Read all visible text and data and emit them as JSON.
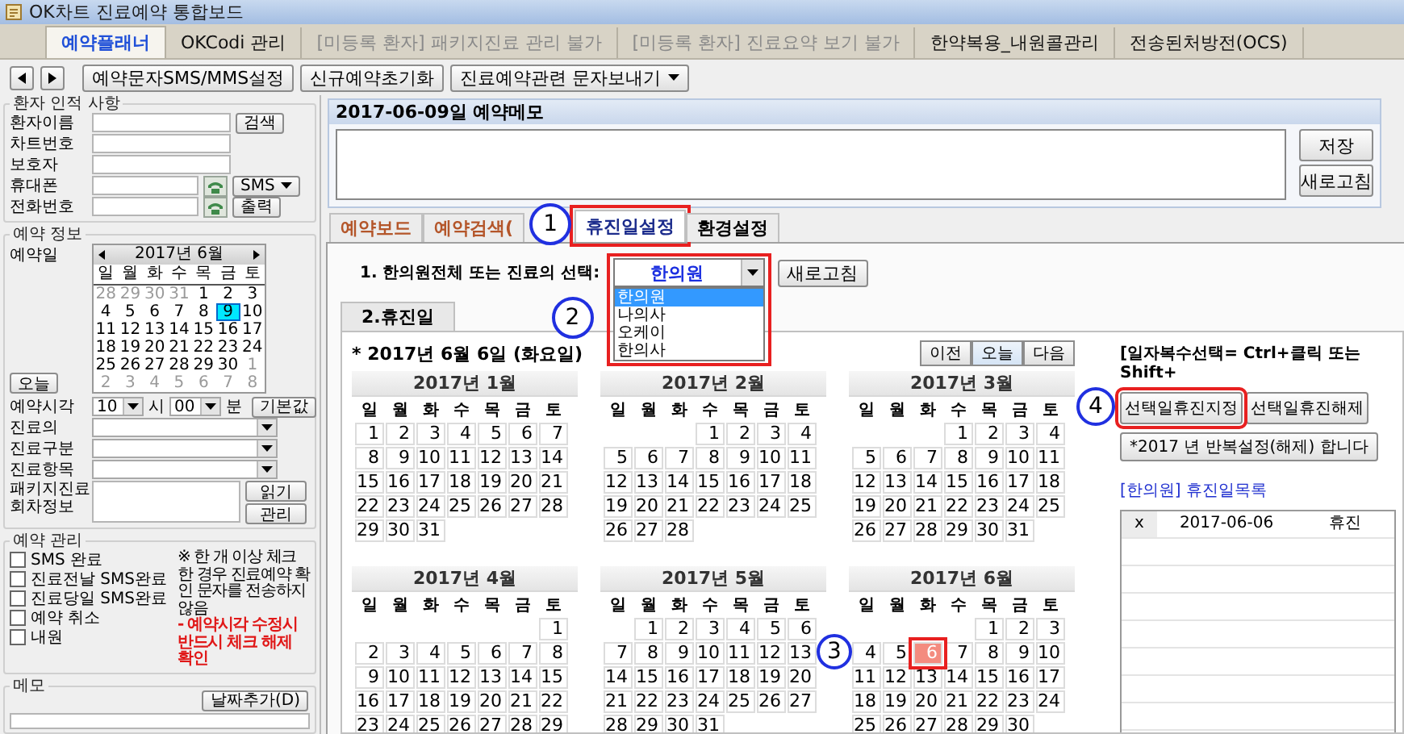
{
  "window": {
    "title": "OK차트 진료예약 통합보드"
  },
  "menu_tabs": [
    {
      "label": "예약플래너",
      "selected": true,
      "disabled": false
    },
    {
      "label": "OKCodi 관리",
      "selected": false,
      "disabled": false
    },
    {
      "label": "[미등록 환자] 패키지진료 관리 불가",
      "selected": false,
      "disabled": true
    },
    {
      "label": "[미등록 환자] 진료요약 보기 불가",
      "selected": false,
      "disabled": true
    },
    {
      "label": "한약복용_내원콜관리",
      "selected": false,
      "disabled": false
    },
    {
      "label": "전송된처방전(OCS)",
      "selected": false,
      "disabled": false
    }
  ],
  "toolbar": {
    "buttons": [
      {
        "label": "예약문자SMS/MMS설정",
        "dropdown": false
      },
      {
        "label": "신규예약초기화",
        "dropdown": false
      },
      {
        "label": "진료예약관련 문자보내기",
        "dropdown": true
      }
    ]
  },
  "patient": {
    "title": "환자 인적 사항",
    "fields": [
      {
        "label": "환자이름",
        "kind": "search",
        "button": "검색",
        "dropdown": false
      },
      {
        "label": "차트번호",
        "kind": "plain"
      },
      {
        "label": "보호자",
        "kind": "plain"
      },
      {
        "label": "휴대폰",
        "kind": "phone",
        "button": "SMS",
        "dropdown": true
      },
      {
        "label": "전화번호",
        "kind": "phone",
        "button": "출력",
        "dropdown": false
      }
    ]
  },
  "reservation": {
    "title": "예약 정보",
    "date_label": "예약일",
    "today_button": "오늘",
    "calendar": {
      "title": "2017년 6월",
      "weekdays": [
        "일",
        "월",
        "화",
        "수",
        "목",
        "금",
        "토"
      ],
      "weeks": [
        [
          {
            "day": "28",
            "other_month": true,
            "selected": false
          },
          {
            "day": "29",
            "other_month": true,
            "selected": false
          },
          {
            "day": "30",
            "other_month": true,
            "selected": false
          },
          {
            "day": "31",
            "other_month": true,
            "selected": false
          },
          {
            "day": "1",
            "other_month": false,
            "selected": false
          },
          {
            "day": "2",
            "other_month": false,
            "selected": false
          },
          {
            "day": "3",
            "other_month": false,
            "selected": false
          }
        ],
        [
          {
            "day": "4",
            "other_month": false,
            "selected": false
          },
          {
            "day": "5",
            "other_month": false,
            "selected": false
          },
          {
            "day": "6",
            "other_month": false,
            "selected": false
          },
          {
            "day": "7",
            "other_month": false,
            "selected": false
          },
          {
            "day": "8",
            "other_month": false,
            "selected": false
          },
          {
            "day": "9",
            "other_month": false,
            "selected": true
          },
          {
            "day": "10",
            "other_month": false,
            "selected": false
          }
        ],
        [
          {
            "day": "11",
            "other_month": false,
            "selected": false
          },
          {
            "day": "12",
            "other_month": false,
            "selected": false
          },
          {
            "day": "13",
            "other_month": false,
            "selected": false
          },
          {
            "day": "14",
            "other_month": false,
            "selected": false
          },
          {
            "day": "15",
            "other_month": false,
            "selected": false
          },
          {
            "day": "16",
            "other_month": false,
            "selected": false
          },
          {
            "day": "17",
            "other_month": false,
            "selected": false
          }
        ],
        [
          {
            "day": "18",
            "other_month": false,
            "selected": false
          },
          {
            "day": "19",
            "other_month": false,
            "selected": false
          },
          {
            "day": "20",
            "other_month": false,
            "selected": false
          },
          {
            "day": "21",
            "other_month": false,
            "selected": false
          },
          {
            "day": "22",
            "other_month": false,
            "selected": false
          },
          {
            "day": "23",
            "other_month": false,
            "selected": false
          },
          {
            "day": "24",
            "other_month": false,
            "selected": false
          }
        ],
        [
          {
            "day": "25",
            "other_month": false,
            "selected": false
          },
          {
            "day": "26",
            "other_month": false,
            "selected": false
          },
          {
            "day": "27",
            "other_month": false,
            "selected": false
          },
          {
            "day": "28",
            "other_month": false,
            "selected": false
          },
          {
            "day": "29",
            "other_month": false,
            "selected": false
          },
          {
            "day": "30",
            "other_month": false,
            "selected": false
          },
          {
            "day": "1",
            "other_month": true,
            "selected": false
          }
        ],
        [
          {
            "day": "2",
            "other_month": true,
            "selected": false
          },
          {
            "day": "3",
            "other_month": true,
            "selected": false
          },
          {
            "day": "4",
            "other_month": true,
            "selected": false
          },
          {
            "day": "5",
            "other_month": true,
            "selected": false
          },
          {
            "day": "6",
            "other_month": true,
            "selected": false
          },
          {
            "day": "7",
            "other_month": true,
            "selected": false
          },
          {
            "day": "8",
            "other_month": true,
            "selected": false
          }
        ]
      ]
    },
    "time": {
      "label": "예약시각",
      "hour": "10",
      "hour_unit": "시",
      "minute": "00",
      "minute_unit": "분",
      "default_button": "기본값"
    },
    "selects": [
      {
        "label": "진료의"
      },
      {
        "label": "진료구분"
      },
      {
        "label": "진료항목"
      }
    ],
    "package": {
      "label": "패키지진료 회차정보",
      "buttons": [
        "읽기",
        "관리"
      ]
    }
  },
  "management": {
    "title": "예약 관리",
    "checks": [
      {
        "label": "SMS 완료",
        "checked": false
      },
      {
        "label": "진료전날 SMS완료",
        "checked": false
      },
      {
        "label": "진료당일 SMS완료",
        "checked": false
      },
      {
        "label": "예약 취소",
        "checked": false
      },
      {
        "label": "내원",
        "checked": false
      }
    ],
    "note": "※ 한 개 이상 체크한 경우 진료예약 확인 문자를 전송하지 않음",
    "warning": "- 예약시각 수정시 반드시 체크 해제 확인"
  },
  "side_memo": {
    "title": "메모",
    "button": "날짜추가(D)"
  },
  "memo": {
    "title": "2017-06-09일 예약메모",
    "buttons": [
      "저장",
      "새로고침"
    ]
  },
  "main_tabs": [
    {
      "label": "예약보드",
      "selected": false,
      "color": "#b4562a"
    },
    {
      "label": "예약검색(",
      "selected": false,
      "color": "#b4562a"
    },
    {
      "label": "휴진일설정",
      "selected": true,
      "color": "#1c2c8c",
      "marker": "1"
    },
    {
      "label": "환경설정",
      "selected": false,
      "color": "#000000"
    }
  ],
  "holiday": {
    "select_label": "1. 한의원전체 또는 진료의 선택:",
    "select": {
      "value": "한의원",
      "expanded": true,
      "marker": "2",
      "options": [
        {
          "label": "한의원",
          "selected": true
        },
        {
          "label": "나의사",
          "selected": false
        },
        {
          "label": "오케이",
          "selected": false
        },
        {
          "label": "한의사",
          "selected": false
        }
      ]
    },
    "refresh_button": "새로고침",
    "subtab": "2.휴진일",
    "caption": "* 2017년 6월 6일 (화요일)",
    "nav": [
      {
        "label": "이전",
        "selected": false
      },
      {
        "label": "오늘",
        "selected": true
      },
      {
        "label": "다음",
        "selected": false
      }
    ],
    "months": [
      {
        "title": "2017년 1월",
        "weekdays": [
          "일",
          "월",
          "화",
          "수",
          "목",
          "금",
          "토"
        ],
        "weeks": [
          [
            {
              "day": "1",
              "selected": false
            },
            {
              "day": "2",
              "selected": false
            },
            {
              "day": "3",
              "selected": false
            },
            {
              "day": "4",
              "selected": false
            },
            {
              "day": "5",
              "selected": false
            },
            {
              "day": "6",
              "selected": false
            },
            {
              "day": "7",
              "selected": false
            }
          ],
          [
            {
              "day": "8",
              "selected": false
            },
            {
              "day": "9",
              "selected": false
            },
            {
              "day": "10",
              "selected": false
            },
            {
              "day": "11",
              "selected": false
            },
            {
              "day": "12",
              "selected": false
            },
            {
              "day": "13",
              "selected": false
            },
            {
              "day": "14",
              "selected": false
            }
          ],
          [
            {
              "day": "15",
              "selected": false
            },
            {
              "day": "16",
              "selected": false
            },
            {
              "day": "17",
              "selected": false
            },
            {
              "day": "18",
              "selected": false
            },
            {
              "day": "19",
              "selected": false
            },
            {
              "day": "20",
              "selected": false
            },
            {
              "day": "21",
              "selected": false
            }
          ],
          [
            {
              "day": "22",
              "selected": false
            },
            {
              "day": "23",
              "selected": false
            },
            {
              "day": "24",
              "selected": false
            },
            {
              "day": "25",
              "selected": false
            },
            {
              "day": "26",
              "selected": false
            },
            {
              "day": "27",
              "selected": false
            },
            {
              "day": "28",
              "selected": false
            }
          ],
          [
            {
              "day": "29",
              "selected": false
            },
            {
              "day": "30",
              "selected": false
            },
            {
              "day": "31",
              "selected": false
            }
          ]
        ]
      },
      {
        "title": "2017년 2월",
        "weekdays": [
          "일",
          "월",
          "화",
          "수",
          "목",
          "금",
          "토"
        ],
        "weeks": [
          [
            {
              "day": "1",
              "selected": false
            },
            {
              "day": "2",
              "selected": false
            },
            {
              "day": "3",
              "selected": false
            },
            {
              "day": "4",
              "selected": false
            }
          ],
          [
            {
              "day": "5",
              "selected": false
            },
            {
              "day": "6",
              "selected": false
            },
            {
              "day": "7",
              "selected": false
            },
            {
              "day": "8",
              "selected": false
            },
            {
              "day": "9",
              "selected": false
            },
            {
              "day": "10",
              "selected": false
            },
            {
              "day": "11",
              "selected": false
            }
          ],
          [
            {
              "day": "12",
              "selected": false
            },
            {
              "day": "13",
              "selected": false
            },
            {
              "day": "14",
              "selected": false
            },
            {
              "day": "15",
              "selected": false
            },
            {
              "day": "16",
              "selected": false
            },
            {
              "day": "17",
              "selected": false
            },
            {
              "day": "18",
              "selected": false
            }
          ],
          [
            {
              "day": "19",
              "selected": false
            },
            {
              "day": "20",
              "selected": false
            },
            {
              "day": "21",
              "selected": false
            },
            {
              "day": "22",
              "selected": false
            },
            {
              "day": "23",
              "selected": false
            },
            {
              "day": "24",
              "selected": false
            },
            {
              "day": "25",
              "selected": false
            }
          ],
          [
            {
              "day": "26",
              "selected": false
            },
            {
              "day": "27",
              "selected": false
            },
            {
              "day": "28",
              "selected": false
            }
          ]
        ]
      },
      {
        "title": "2017년 3월",
        "weekdays": [
          "일",
          "월",
          "화",
          "수",
          "목",
          "금",
          "토"
        ],
        "weeks": [
          [
            {
              "day": "1",
              "selected": false
            },
            {
              "day": "2",
              "selected": false
            },
            {
              "day": "3",
              "selected": false
            },
            {
              "day": "4",
              "selected": false
            }
          ],
          [
            {
              "day": "5",
              "selected": false
            },
            {
              "day": "6",
              "selected": false
            },
            {
              "day": "7",
              "selected": false
            },
            {
              "day": "8",
              "selected": false
            },
            {
              "day": "9",
              "selected": false
            },
            {
              "day": "10",
              "selected": false
            },
            {
              "day": "11",
              "selected": false
            }
          ],
          [
            {
              "day": "12",
              "selected": false
            },
            {
              "day": "13",
              "selected": false
            },
            {
              "day": "14",
              "selected": false
            },
            {
              "day": "15",
              "selected": false
            },
            {
              "day": "16",
              "selected": false
            },
            {
              "day": "17",
              "selected": false
            },
            {
              "day": "18",
              "selected": false
            }
          ],
          [
            {
              "day": "19",
              "selected": false
            },
            {
              "day": "20",
              "selected": false
            },
            {
              "day": "21",
              "selected": false
            },
            {
              "day": "22",
              "selected": false
            },
            {
              "day": "23",
              "selected": false
            },
            {
              "day": "24",
              "selected": false
            },
            {
              "day": "25",
              "selected": false
            }
          ],
          [
            {
              "day": "26",
              "selected": false
            },
            {
              "day": "27",
              "selected": false
            },
            {
              "day": "28",
              "selected": false
            },
            {
              "day": "29",
              "selected": false
            },
            {
              "day": "30",
              "selected": false
            },
            {
              "day": "31",
              "selected": false
            }
          ]
        ]
      },
      {
        "title": "2017년 4월",
        "weekdays": [
          "일",
          "월",
          "화",
          "수",
          "목",
          "금",
          "토"
        ],
        "weeks": [
          [
            {
              "day": "1",
              "selected": false
            }
          ],
          [
            {
              "day": "2",
              "selected": false
            },
            {
              "day": "3",
              "selected": false
            },
            {
              "day": "4",
              "selected": false
            },
            {
              "day": "5",
              "selected": false
            },
            {
              "day": "6",
              "selected": false
            },
            {
              "day": "7",
              "selected": false
            },
            {
              "day": "8",
              "selected": false
            }
          ],
          [
            {
              "day": "9",
              "selected": false
            },
            {
              "day": "10",
              "selected": false
            },
            {
              "day": "11",
              "selected": false
            },
            {
              "day": "12",
              "selected": false
            },
            {
              "day": "13",
              "selected": false
            },
            {
              "day": "14",
              "selected": false
            },
            {
              "day": "15",
              "selected": false
            }
          ],
          [
            {
              "day": "16",
              "selected": false
            },
            {
              "day": "17",
              "selected": false
            },
            {
              "day": "18",
              "selected": false
            },
            {
              "day": "19",
              "selected": false
            },
            {
              "day": "20",
              "selected": false
            },
            {
              "day": "21",
              "selected": false
            },
            {
              "day": "22",
              "selected": false
            }
          ],
          [
            {
              "day": "23",
              "selected": false
            },
            {
              "day": "24",
              "selected": false
            },
            {
              "day": "25",
              "selected": false
            },
            {
              "day": "26",
              "selected": false
            },
            {
              "day": "27",
              "selected": false
            },
            {
              "day": "28",
              "selected": false
            },
            {
              "day": "29",
              "selected": false
            }
          ]
        ]
      },
      {
        "title": "2017년 5월",
        "weekdays": [
          "일",
          "월",
          "화",
          "수",
          "목",
          "금",
          "토"
        ],
        "weeks": [
          [
            {
              "day": "1",
              "selected": false
            },
            {
              "day": "2",
              "selected": false
            },
            {
              "day": "3",
              "selected": false
            },
            {
              "day": "4",
              "selected": false
            },
            {
              "day": "5",
              "selected": false
            },
            {
              "day": "6",
              "selected": false
            }
          ],
          [
            {
              "day": "7",
              "selected": false
            },
            {
              "day": "8",
              "selected": false
            },
            {
              "day": "9",
              "selected": false
            },
            {
              "day": "10",
              "selected": false
            },
            {
              "day": "11",
              "selected": false
            },
            {
              "day": "12",
              "selected": false
            },
            {
              "day": "13",
              "selected": false
            }
          ],
          [
            {
              "day": "14",
              "selected": false
            },
            {
              "day": "15",
              "selected": false
            },
            {
              "day": "16",
              "selected": false
            },
            {
              "day": "17",
              "selected": false
            },
            {
              "day": "18",
              "selected": false
            },
            {
              "day": "19",
              "selected": false
            },
            {
              "day": "20",
              "selected": false
            }
          ],
          [
            {
              "day": "21",
              "selected": false
            },
            {
              "day": "22",
              "selected": false
            },
            {
              "day": "23",
              "selected": false
            },
            {
              "day": "24",
              "selected": false
            },
            {
              "day": "25",
              "selected": false
            },
            {
              "day": "26",
              "selected": false
            },
            {
              "day": "27",
              "selected": false
            }
          ],
          [
            {
              "day": "28",
              "selected": false
            },
            {
              "day": "29",
              "selected": false
            },
            {
              "day": "30",
              "selected": false
            },
            {
              "day": "31",
              "selected": false
            }
          ]
        ]
      },
      {
        "title": "2017년 6월",
        "weekdays": [
          "일",
          "월",
          "화",
          "수",
          "목",
          "금",
          "토"
        ],
        "weeks": [
          [
            {
              "day": "1",
              "selected": false
            },
            {
              "day": "2",
              "selected": false
            },
            {
              "day": "3",
              "selected": false
            }
          ],
          [
            {
              "day": "4",
              "selected": false
            },
            {
              "day": "5",
              "selected": false
            },
            {
              "day": "6",
              "selected": true,
              "marker": "3"
            },
            {
              "day": "7",
              "selected": false
            },
            {
              "day": "8",
              "selected": false
            },
            {
              "day": "9",
              "selected": false
            },
            {
              "day": "10",
              "selected": false
            }
          ],
          [
            {
              "day": "11",
              "selected": false
            },
            {
              "day": "12",
              "selected": false
            },
            {
              "day": "13",
              "selected": false
            },
            {
              "day": "14",
              "selected": false
            },
            {
              "day": "15",
              "selected": false
            },
            {
              "day": "16",
              "selected": false
            },
            {
              "day": "17",
              "selected": false
            }
          ],
          [
            {
              "day": "18",
              "selected": false
            },
            {
              "day": "19",
              "selected": false
            },
            {
              "day": "20",
              "selected": false
            },
            {
              "day": "21",
              "selected": false
            },
            {
              "day": "22",
              "selected": false
            },
            {
              "day": "23",
              "selected": false
            },
            {
              "day": "24",
              "selected": false
            }
          ],
          [
            {
              "day": "25",
              "selected": false
            },
            {
              "day": "26",
              "selected": false
            },
            {
              "day": "27",
              "selected": false
            },
            {
              "day": "28",
              "selected": false
            },
            {
              "day": "29",
              "selected": false
            },
            {
              "day": "30",
              "selected": false
            }
          ]
        ]
      }
    ],
    "hint": "[일자복수선택= Ctrl+클릭 또는 Shift+",
    "actions": [
      {
        "label": "선택일휴진지정",
        "marker": "4"
      },
      {
        "label": "선택일휴진해제"
      }
    ],
    "repeat_button": "*2017 년 반복설정(해제) 합니다",
    "list_title": "[한의원] 휴진일목록",
    "list_rows": [
      {
        "cells": [
          "x",
          "2017-06-06",
          "휴진"
        ]
      }
    ]
  }
}
